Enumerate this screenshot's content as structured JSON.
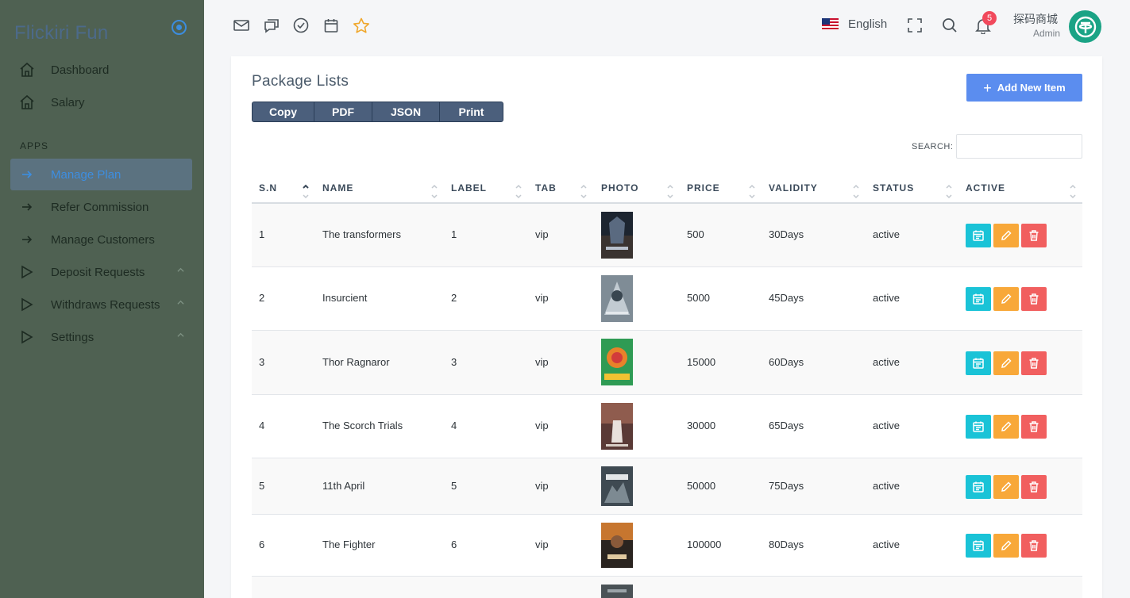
{
  "brand": {
    "name": "Flickiri Fun"
  },
  "sidebar": {
    "items": [
      {
        "label": "Dashboard",
        "icon": "home-icon"
      },
      {
        "label": "Salary",
        "icon": "home-icon"
      }
    ],
    "section_label": "APPS",
    "apps": [
      {
        "label": "Manage Plan",
        "icon": "arrow-right-icon",
        "active": true
      },
      {
        "label": "Refer Commission",
        "icon": "arrow-right-icon"
      },
      {
        "label": "Manage Customers",
        "icon": "arrow-right-icon"
      },
      {
        "label": "Deposit Requests",
        "icon": "play-icon",
        "expandable": true
      },
      {
        "label": "Withdraws Requests",
        "icon": "play-icon",
        "expandable": true
      },
      {
        "label": "Settings",
        "icon": "play-icon",
        "expandable": true
      }
    ]
  },
  "topbar": {
    "icons": [
      "mail-icon",
      "chat-icon",
      "check-circle-icon",
      "calendar-icon",
      "star-icon"
    ],
    "language": "English",
    "notification_count": "5",
    "user_name": "探码商城",
    "user_role": "Admin"
  },
  "page": {
    "title": "Package Lists",
    "export_buttons": [
      "Copy",
      "PDF",
      "JSON",
      "Print"
    ],
    "add_button": "Add New Item",
    "search_label": "SEARCH:",
    "search_value": ""
  },
  "table": {
    "columns": [
      "S.N",
      "NAME",
      "LABEL",
      "TAB",
      "PHOTO",
      "PRICE",
      "VALIDITY",
      "STATUS",
      "ACTIVE"
    ],
    "rows": [
      {
        "sn": "1",
        "name": "The transformers",
        "label": "1",
        "tab": "vip",
        "price": "500",
        "validity": "30Days",
        "status": "active"
      },
      {
        "sn": "2",
        "name": "Insurcient",
        "label": "2",
        "tab": "vip",
        "price": "5000",
        "validity": "45Days",
        "status": "active"
      },
      {
        "sn": "3",
        "name": "Thor Ragnaror",
        "label": "3",
        "tab": "vip",
        "price": "15000",
        "validity": "60Days",
        "status": "active"
      },
      {
        "sn": "4",
        "name": "The Scorch Trials",
        "label": "4",
        "tab": "vip",
        "price": "30000",
        "validity": "65Days",
        "status": "active"
      },
      {
        "sn": "5",
        "name": "11th April",
        "label": "5",
        "tab": "vip",
        "price": "50000",
        "validity": "75Days",
        "status": "active"
      },
      {
        "sn": "6",
        "name": "The Fighter",
        "label": "6",
        "tab": "vip",
        "price": "100000",
        "validity": "80Days",
        "status": "active"
      }
    ]
  },
  "colors": {
    "sidebar_bg": "#4f6152",
    "accent": "#5b8def",
    "view_button": "#1ac3d7",
    "edit_button": "#f8a839",
    "delete_button": "#f15f5f"
  }
}
